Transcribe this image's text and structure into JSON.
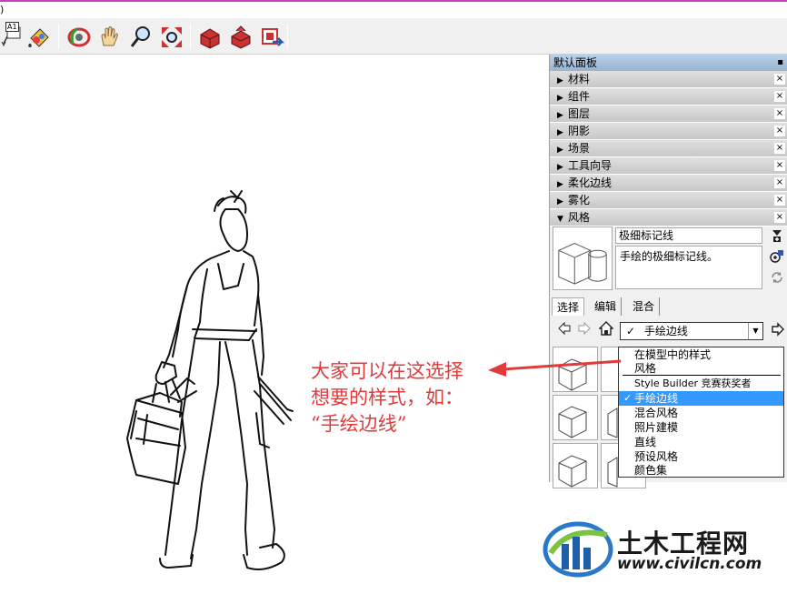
{
  "menubar": {
    "fragment": ")"
  },
  "toolbar": {
    "a1_label": "A1",
    "tools": [
      "text-tool",
      "paint-bucket",
      "orbit",
      "pan",
      "zoom",
      "zoom-extents",
      "warehouse-get",
      "warehouse-share",
      "extension"
    ]
  },
  "panel": {
    "title": "默认面板",
    "pin": "📌",
    "close": "×",
    "trays": [
      {
        "label": "材料",
        "arrow": "▶"
      },
      {
        "label": "组件",
        "arrow": "▶"
      },
      {
        "label": "图层",
        "arrow": "▶"
      },
      {
        "label": "阴影",
        "arrow": "▶"
      },
      {
        "label": "场景",
        "arrow": "▶"
      },
      {
        "label": "工具向导",
        "arrow": "▶"
      },
      {
        "label": "柔化边线",
        "arrow": "▶"
      },
      {
        "label": "雾化",
        "arrow": "▶"
      },
      {
        "label": "风格",
        "arrow": "▼"
      }
    ],
    "style": {
      "name": "极细标记线",
      "description": "手绘的极细标记线。"
    },
    "tabs": [
      "选择",
      "编辑",
      "混合"
    ],
    "select": {
      "check": "✓",
      "value": "手绘边线"
    }
  },
  "dropdown": {
    "options": [
      {
        "label": "在模型中的样式",
        "selected": false
      },
      {
        "label": "风格",
        "selected": false
      },
      {
        "label": "Style Builder 竞赛获奖者",
        "selected": false
      },
      {
        "label": "手绘边线",
        "selected": true,
        "check": "✓"
      },
      {
        "label": "混合风格",
        "selected": false
      },
      {
        "label": "照片建模",
        "selected": false
      },
      {
        "label": "直线",
        "selected": false
      },
      {
        "label": "预设风格",
        "selected": false
      },
      {
        "label": "颜色集",
        "selected": false
      }
    ]
  },
  "annotation": {
    "lines": [
      "大家可以在这选择",
      "想要的样式，如：",
      "“手绘边线”"
    ],
    "color": "#e03a3a"
  },
  "logo": {
    "title": "土木工程网",
    "url": "www.civilcn.com"
  }
}
